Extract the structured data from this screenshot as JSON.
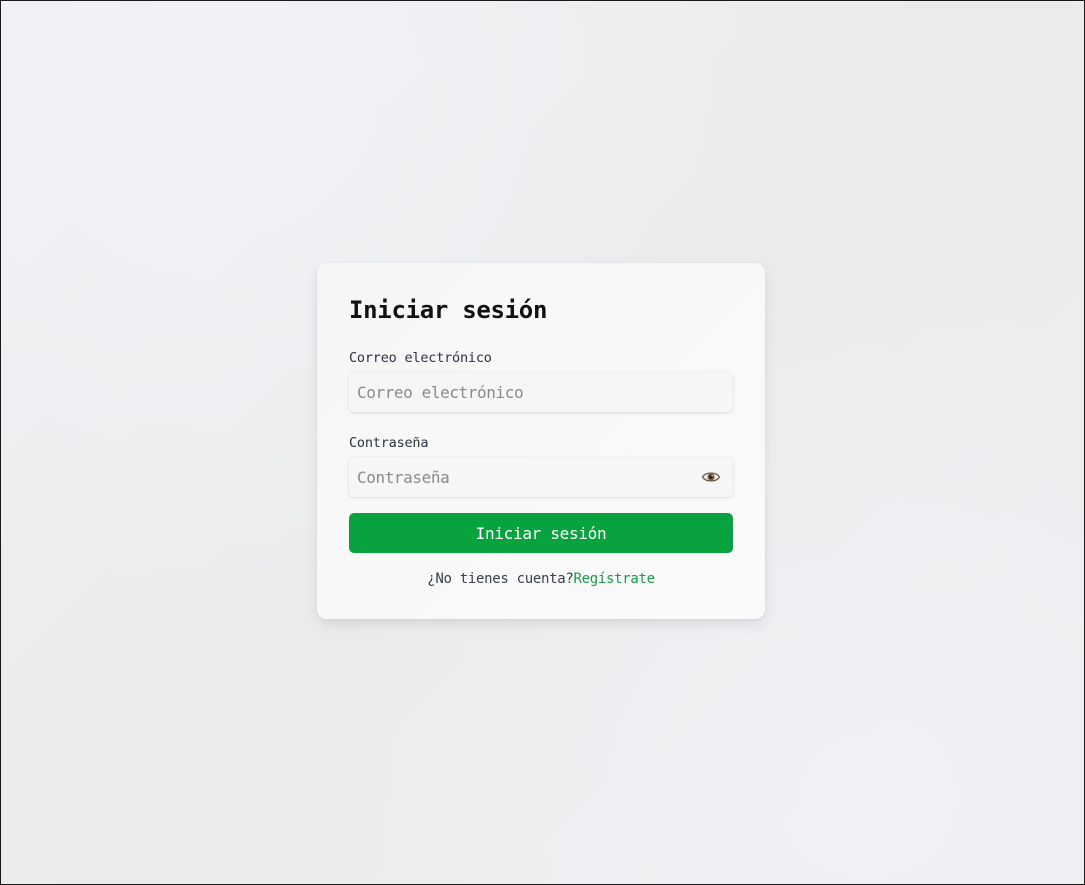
{
  "login": {
    "title": "Iniciar sesión",
    "email_label": "Correo electrónico",
    "email_placeholder": "Correo electrónico",
    "email_value": "",
    "password_label": "Contraseña",
    "password_placeholder": "Contraseña",
    "password_value": "",
    "password_toggle_icon": "eye-icon",
    "submit_label": "Iniciar sesión",
    "no_account_text": "¿No tienes cuenta?",
    "register_link": "Regístrate"
  },
  "colors": {
    "accent": "#08a33f",
    "link": "#1a9a4a"
  }
}
